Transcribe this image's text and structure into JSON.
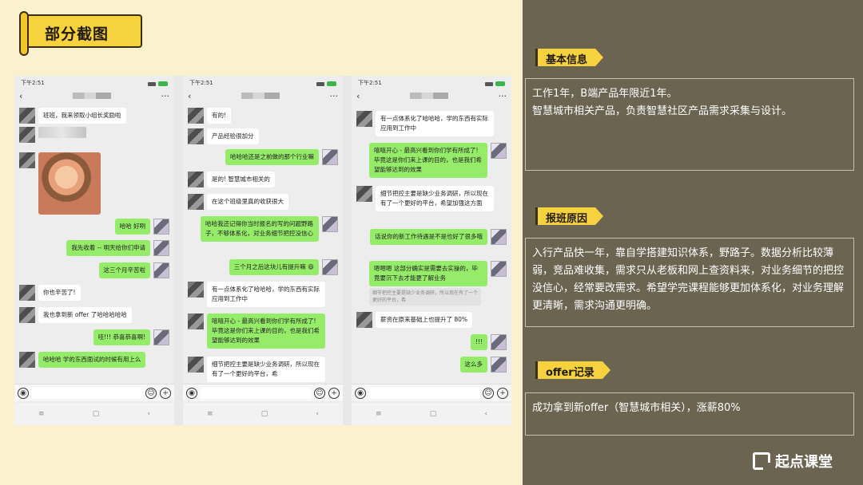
{
  "banner": {
    "title": "部分截图"
  },
  "phones": [
    {
      "time": "下午2:51",
      "messages": [
        {
          "side": "left",
          "type": "text",
          "text": "班班，我来领取小组长奖励啦"
        },
        {
          "side": "left",
          "type": "blur"
        },
        {
          "side": "left",
          "type": "photo"
        },
        {
          "side": "right",
          "type": "text",
          "text": "哈哈 好咧"
        },
        {
          "side": "right",
          "type": "text",
          "text": "我先收着 -- 明天给你们申请"
        },
        {
          "side": "right",
          "type": "text",
          "text": "这三个月辛苦啦"
        },
        {
          "side": "left",
          "type": "text",
          "text": "你也辛苦了!"
        },
        {
          "side": "left",
          "type": "text",
          "text": "我也拿到新 offer 了哈哈哈哈哈"
        },
        {
          "side": "right",
          "type": "text",
          "text": "哇!!! 恭喜恭喜啊!"
        },
        {
          "side": "left",
          "type": "text",
          "text": "哈哈哈 学的东西面试的时候有用上么",
          "green": true
        }
      ]
    },
    {
      "time": "下午2:51",
      "messages": [
        {
          "side": "left",
          "type": "text",
          "text": "有的!"
        },
        {
          "side": "left",
          "type": "text",
          "text": "产品经验很加分"
        },
        {
          "side": "right",
          "type": "text",
          "text": "哈哈哈还是之前做的那个行业嘛"
        },
        {
          "side": "left",
          "type": "text",
          "text": "是的! 智慧城市相关的"
        },
        {
          "side": "left",
          "type": "text",
          "text": "在这个班级里真的收获很大"
        },
        {
          "side": "right",
          "type": "text",
          "text": "哈哈我还记得你当时报名的写的问题野路子，不够体系化，对业务细节把控没信心"
        },
        {
          "side": "right",
          "type": "text",
          "text": "三个月之后这块儿有提升嘛 😄"
        },
        {
          "side": "left",
          "type": "text",
          "text": "有一点体系化了哈哈哈，学的东西有实际应用到工作中"
        },
        {
          "side": "right",
          "type": "text",
          "text": "嘻嘻开心 - 最高兴看到你们学有所成了! 毕竟这是你们来上课的目的，也是我们希望能够达到的效果"
        },
        {
          "side": "left",
          "type": "text",
          "text": "细节把控主要是缺少业务调研，所以现在有了一个更好的平台，希"
        }
      ]
    },
    {
      "time": "下午2:51",
      "messages": [
        {
          "side": "left",
          "type": "text",
          "text": "有一点体系化了哈哈哈，学的东西有实际应用到工作中"
        },
        {
          "side": "right",
          "type": "text",
          "text": "嘻嘻开心 - 最高兴看到你们学有所成了! 毕竟这是你们来上课的目的，也是我们希望能够达到的效果"
        },
        {
          "side": "left",
          "type": "text",
          "text": "细节把控主要是缺少业务调研，所以现在有了一个更好的平台，希望加强这方面"
        },
        {
          "side": "right",
          "type": "text",
          "text": "话说你的新工作待遇是不是也好了很多哦"
        },
        {
          "side": "right",
          "type": "text",
          "text": "嗯嗯嗯 这部分确实是需要去实操的，毕竟要沉下去才能更了解业务",
          "quote": "细节把控主要是缺少业务调研，所以现在有了一个更好的平台，希"
        },
        {
          "side": "left",
          "type": "text",
          "text": "薪资在原来基础上也提升了 80%"
        },
        {
          "side": "right",
          "type": "text",
          "text": "!!!"
        },
        {
          "side": "right",
          "type": "text",
          "text": "这么多"
        }
      ]
    }
  ],
  "sections": [
    {
      "tag": "基本信息",
      "lines": [
        "工作1年，B端产品年限近1年。",
        "智慧城市相关产品，负责智慧社区产品需求采集与设计。"
      ]
    },
    {
      "tag": "报班原因",
      "lines": [
        "入行产品快一年，靠自学搭建知识体系，野路子。数据分析比较薄弱，竞品难收集，需求只从老板和网上查资料来，对业务细节的把控没信心，经常要改需求。希望学完课程能够更加体系化，对业务理解更清晰，需求沟通更明确。"
      ]
    },
    {
      "tag": "offer记录",
      "lines": [
        "成功拿到新offer（智慧城市相关），涨薪80%"
      ]
    }
  ],
  "logo": {
    "text": "起点课堂"
  },
  "colors": {
    "accent": "#f7d23f",
    "panel": "#6b6450",
    "background": "#fbf1cf",
    "bubble_green": "#95ec69"
  }
}
